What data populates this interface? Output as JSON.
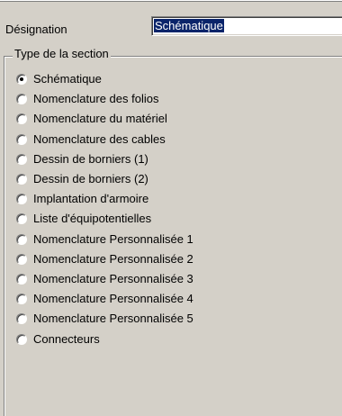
{
  "designation": {
    "label": "Désignation",
    "value": "Schématique"
  },
  "section_type": {
    "title": "Type de la section",
    "selected_index": 0,
    "options": [
      "Schématique",
      "Nomenclature des folios",
      "Nomenclature du matériel",
      "Nomenclature des cables",
      "Dessin de borniers (1)",
      "Dessin de borniers (2)",
      "Implantation d'armoire",
      "Liste d'équipotentielles",
      "Nomenclature Personnalisée 1",
      "Nomenclature Personnalisée 2",
      "Nomenclature Personnalisée 3",
      "Nomenclature Personnalisée 4",
      "Nomenclature Personnalisée 5",
      "Connecteurs"
    ]
  }
}
